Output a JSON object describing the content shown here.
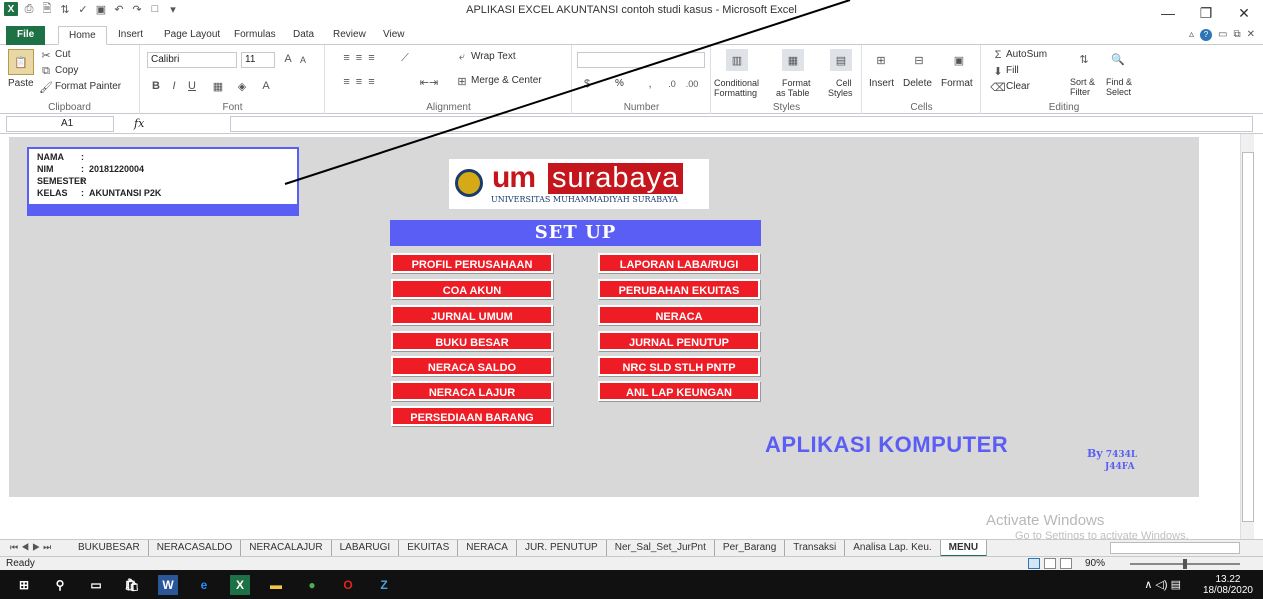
{
  "window": {
    "title": "APLIKASI EXCEL AKUNTANSI contoh studi kasus  -  Microsoft Excel",
    "minimize": "—",
    "restore": "❐",
    "close": "✕"
  },
  "ribbon_tabs": [
    "File",
    "Home",
    "Insert",
    "Page Layout",
    "Formulas",
    "Data",
    "Review",
    "View"
  ],
  "ribbon": {
    "clipboard": {
      "paste": "Paste",
      "cut": "Cut",
      "copy": "Copy",
      "format_painter": "Format Painter",
      "label": "Clipboard"
    },
    "font": {
      "name": "Calibri",
      "size": "11",
      "label": "Font"
    },
    "alignment": {
      "wrap_text": "Wrap Text",
      "merge_center": "Merge & Center",
      "label": "Alignment"
    },
    "number": {
      "label": "Number",
      "percent": "%"
    },
    "styles": {
      "conditional": "Conditional",
      "formatting": "Formatting",
      "format_as": "Format",
      "as_table": "as Table",
      "cell": "Cell",
      "cell_styles": "Styles",
      "label": "Styles"
    },
    "cells": {
      "insert": "Insert",
      "delete": "Delete",
      "format": "Format",
      "label": "Cells"
    },
    "editing": {
      "autosum": "AutoSum",
      "fill": "Fill",
      "clear": "Clear",
      "sort": "Sort &",
      "filter": "Filter",
      "find": "Find &",
      "select": "Select",
      "label": "Editing"
    }
  },
  "formula_bar": {
    "name_box": "A1",
    "fx": "fx",
    "formula": ""
  },
  "identity": {
    "rows": [
      {
        "key": "NAMA",
        "colon": ":",
        "value": ""
      },
      {
        "key": "NIM",
        "colon": ":",
        "value": "20181220004"
      },
      {
        "key": "SEMESTER",
        "colon": ":",
        "value": ""
      },
      {
        "key": "KELAS",
        "colon": ":",
        "value": "AKUNTANSI P2K"
      }
    ]
  },
  "logo": {
    "um": "um",
    "surabaya": "surabaya",
    "university": "UNIVERSITAS MUHAMMADIYAH SURABAYA"
  },
  "setup_title": "SET UP",
  "menu_left": [
    "PROFIL PERUSAHAAN",
    "COA AKUN",
    "JURNAL UMUM",
    "BUKU BESAR",
    "NERACA SALDO",
    "NERACA LAJUR",
    "PERSEDIAAN BARANG"
  ],
  "menu_right": [
    "LAPORAN LABA/RUGI",
    "PERUBAHAN EKUITAS",
    "NERACA",
    "JURNAL PENUTUP",
    "NRC SLD STLH PNTP",
    "ANL LAP KEUNGAN"
  ],
  "footer": {
    "title": "APLIKASI KOMPUTER",
    "by": "By",
    "author1": "7434L",
    "author2": "J44FA"
  },
  "watermark": {
    "line1": "Activate Windows",
    "line2": "Go to Settings to activate Windows."
  },
  "sheet_tabs": [
    "BUKUBESAR",
    "NERACASALDO",
    "NERACALAJUR",
    "LABARUGI",
    "EKUITAS",
    "NERACA",
    "JUR. PENUTUP",
    "Ner_Sal_Set_JurPnt",
    "Per_Barang",
    "Transaksi",
    "Analisa Lap. Keu.",
    "MENU"
  ],
  "active_sheet": "MENU",
  "status": {
    "ready": "Ready",
    "zoom": "90%"
  },
  "taskbar": {
    "time": "13.22",
    "date": "18/08/2020"
  }
}
